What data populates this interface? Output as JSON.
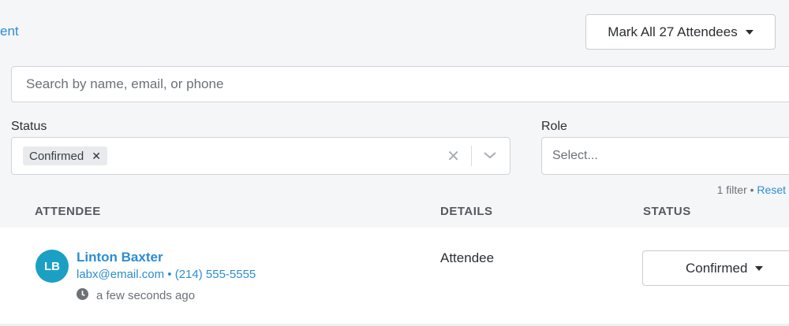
{
  "header": {
    "partial_link": "ent",
    "mark_all_label": "Mark All 27 Attendees"
  },
  "search": {
    "placeholder": "Search by name, email, or phone",
    "value": ""
  },
  "filters": {
    "status_label": "Status",
    "status_selected": [
      "Confirmed"
    ],
    "role_label": "Role",
    "role_placeholder": "Select...",
    "summary": "1 filter",
    "separator": "•",
    "reset_label": "Reset"
  },
  "table": {
    "columns": [
      "ATTENDEE",
      "DETAILS",
      "STATUS"
    ],
    "rows": [
      {
        "initials": "LB",
        "name": "Linton Baxter",
        "email": "labx@email.com",
        "phone": "(214) 555-5555",
        "contact_separator": "•",
        "time": "a few seconds ago",
        "details": "Attendee",
        "status": "Confirmed"
      }
    ]
  },
  "colors": {
    "accent": "#2c8dd1",
    "avatar": "#1ba0c4"
  }
}
